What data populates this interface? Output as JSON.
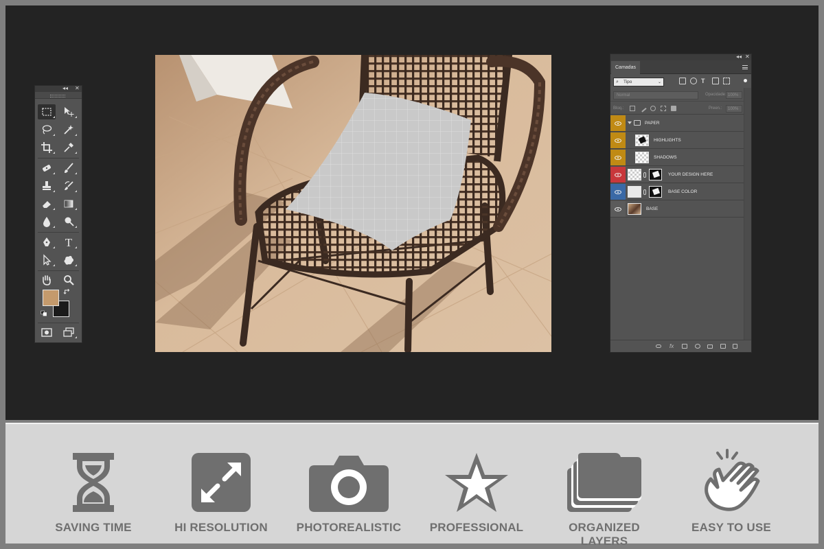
{
  "colors": {
    "workspace_bg": "#232323",
    "panel_bg": "#535353",
    "foreground_swatch": "#c49a6c",
    "background_swatch": "#1b1b1b",
    "feature_icon": "#6f6f6f",
    "feature_bar_bg": "#d6d6d6"
  },
  "tools_panel": {
    "collapse_glyph": "◂◂",
    "close_glyph": "✕",
    "tools": [
      "rectangular-marquee-icon",
      "move-icon",
      "lasso-icon",
      "magic-wand-icon",
      "crop-icon",
      "eyedropper-icon",
      "spot-healing-icon",
      "brush-icon",
      "clone-stamp-icon",
      "history-brush-icon",
      "eraser-icon",
      "gradient-icon",
      "blur-icon",
      "dodge-icon",
      "pen-icon",
      "type-icon",
      "path-selection-icon",
      "custom-shape-icon",
      "hand-icon",
      "zoom-icon",
      "quick-mask-icon",
      "screen-mode-icon"
    ],
    "type_glyph": "T"
  },
  "layers_panel": {
    "collapse_glyph": "◂◂",
    "close_glyph": "✕",
    "tab_label": "Camadas",
    "filter": {
      "search_glyph": "⌕",
      "value": "Tipo",
      "dropdown_glyph": "⌄"
    },
    "blend_mode": "Normal",
    "opacity_label": "Opacidade:",
    "opacity_value": "100%",
    "lock_label": "Bloq.:",
    "fill_label": "Preen.:",
    "fill_value": "100%",
    "layers": [
      {
        "name": "PAPER",
        "kind": "group",
        "tag_color": "yellow"
      },
      {
        "name": "HIGHLIGHTS",
        "kind": "layer",
        "tag_color": "yellow"
      },
      {
        "name": "SHADOWS",
        "kind": "layer",
        "tag_color": "yellow"
      },
      {
        "name": "YOUR DESIGN HERE",
        "kind": "smart-object",
        "tag_color": "red"
      },
      {
        "name": "BASE COLOR",
        "kind": "fill",
        "tag_color": "blue"
      },
      {
        "name": "BASE",
        "kind": "image",
        "tag_color": "none"
      }
    ]
  },
  "features": [
    {
      "label": "SAVING TIME",
      "icon": "hourglass-icon"
    },
    {
      "label": "HI RESOLUTION",
      "icon": "expand-arrows-icon"
    },
    {
      "label": "PHOTOREALISTIC",
      "icon": "camera-icon"
    },
    {
      "label": "PROFESSIONAL",
      "icon": "star-icon"
    },
    {
      "label": "ORGANIZED LAYERS",
      "icon": "stacked-folders-icon"
    },
    {
      "label": "EASY TO USE",
      "icon": "tap-hand-icon"
    }
  ]
}
